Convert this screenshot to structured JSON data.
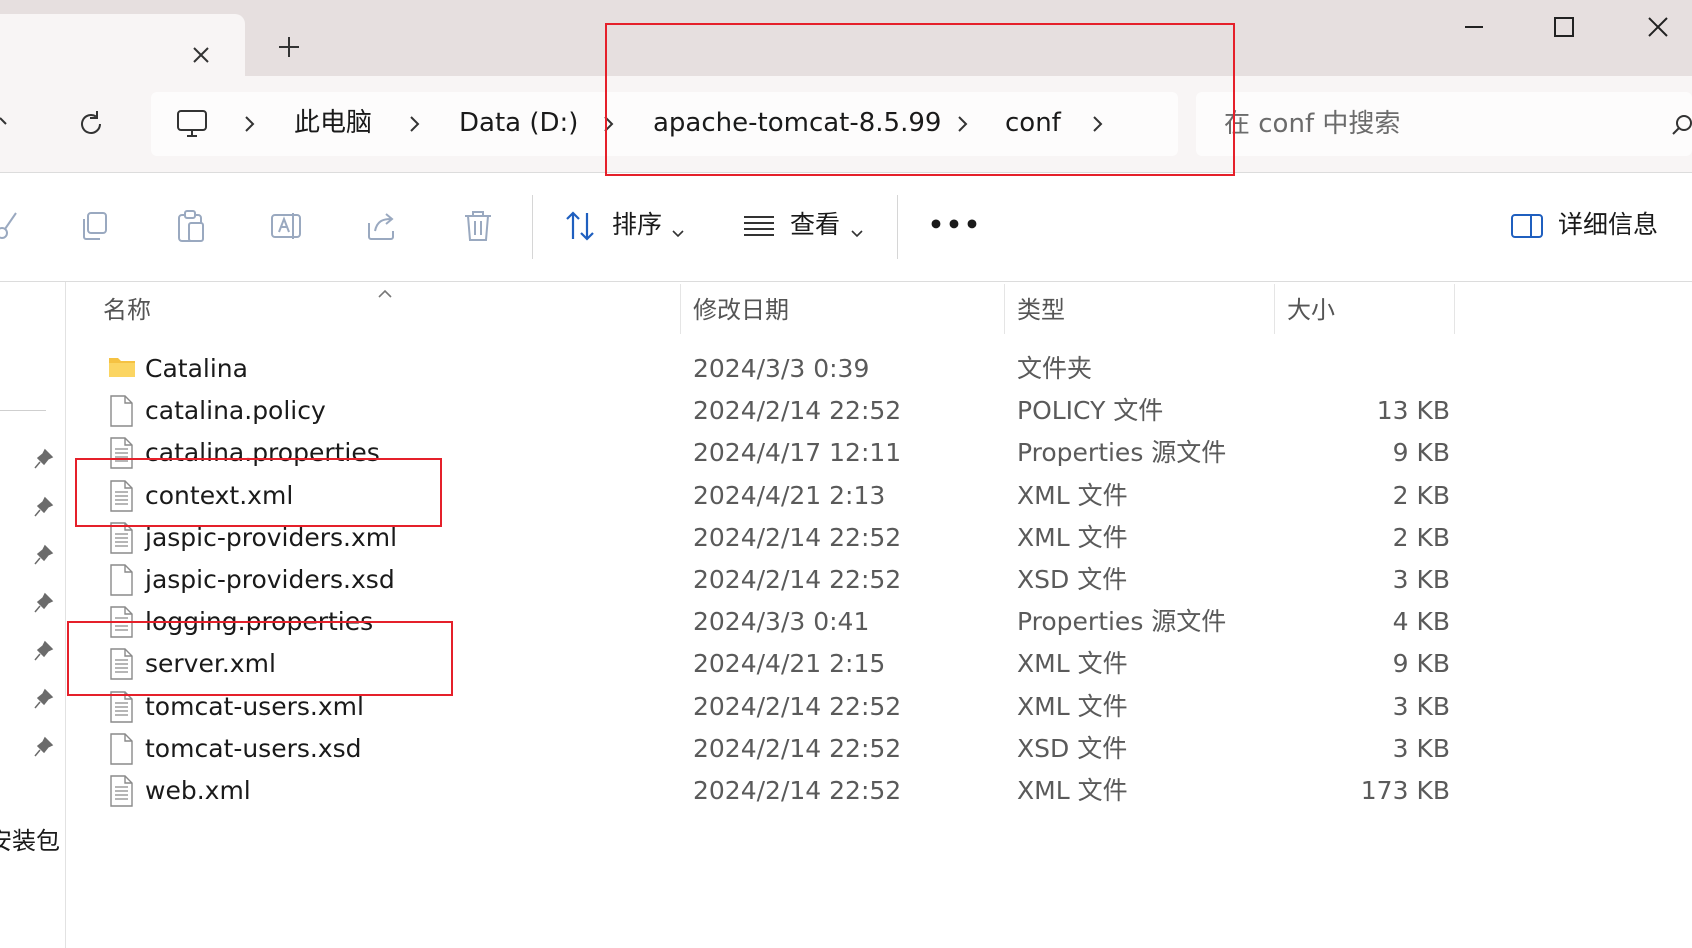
{
  "breadcrumbs": [
    "此电脑",
    "Data (D:)",
    "apache-tomcat-8.5.99",
    "conf"
  ],
  "search": {
    "placeholder": "在 conf 中搜索"
  },
  "toolbar": {
    "sort_label": "排序",
    "view_label": "查看",
    "details_label": "详细信息",
    "more_label": "•••"
  },
  "columns": {
    "name": "名称",
    "modified": "修改日期",
    "type": "类型",
    "size": "大小"
  },
  "navpane": {
    "label": "安装包"
  },
  "files": [
    {
      "name": "Catalina",
      "modified": "2024/3/3 0:39",
      "type": "文件夹",
      "size": "",
      "icon": "folder-icon"
    },
    {
      "name": "catalina.policy",
      "modified": "2024/2/14 22:52",
      "type": "POLICY 文件",
      "size": "13 KB",
      "icon": "blank-file-icon"
    },
    {
      "name": "catalina.properties",
      "modified": "2024/4/17 12:11",
      "type": "Properties 源文件",
      "size": "9 KB",
      "icon": "text-file-icon"
    },
    {
      "name": "context.xml",
      "modified": "2024/4/21 2:13",
      "type": "XML 文件",
      "size": "2 KB",
      "icon": "text-file-icon"
    },
    {
      "name": "jaspic-providers.xml",
      "modified": "2024/2/14 22:52",
      "type": "XML 文件",
      "size": "2 KB",
      "icon": "text-file-icon"
    },
    {
      "name": "jaspic-providers.xsd",
      "modified": "2024/2/14 22:52",
      "type": "XSD 文件",
      "size": "3 KB",
      "icon": "blank-file-icon"
    },
    {
      "name": "logging.properties",
      "modified": "2024/3/3 0:41",
      "type": "Properties 源文件",
      "size": "4 KB",
      "icon": "text-file-icon"
    },
    {
      "name": "server.xml",
      "modified": "2024/4/21 2:15",
      "type": "XML 文件",
      "size": "9 KB",
      "icon": "text-file-icon"
    },
    {
      "name": "tomcat-users.xml",
      "modified": "2024/2/14 22:52",
      "type": "XML 文件",
      "size": "3 KB",
      "icon": "text-file-icon"
    },
    {
      "name": "tomcat-users.xsd",
      "modified": "2024/2/14 22:52",
      "type": "XSD 文件",
      "size": "3 KB",
      "icon": "blank-file-icon"
    },
    {
      "name": "web.xml",
      "modified": "2024/2/14 22:52",
      "type": "XML 文件",
      "size": "173 KB",
      "icon": "text-file-icon"
    }
  ],
  "colors": {
    "annotation": "#e5202a",
    "tabstrip": "#e6dfdf",
    "folder": "#f5c242"
  }
}
